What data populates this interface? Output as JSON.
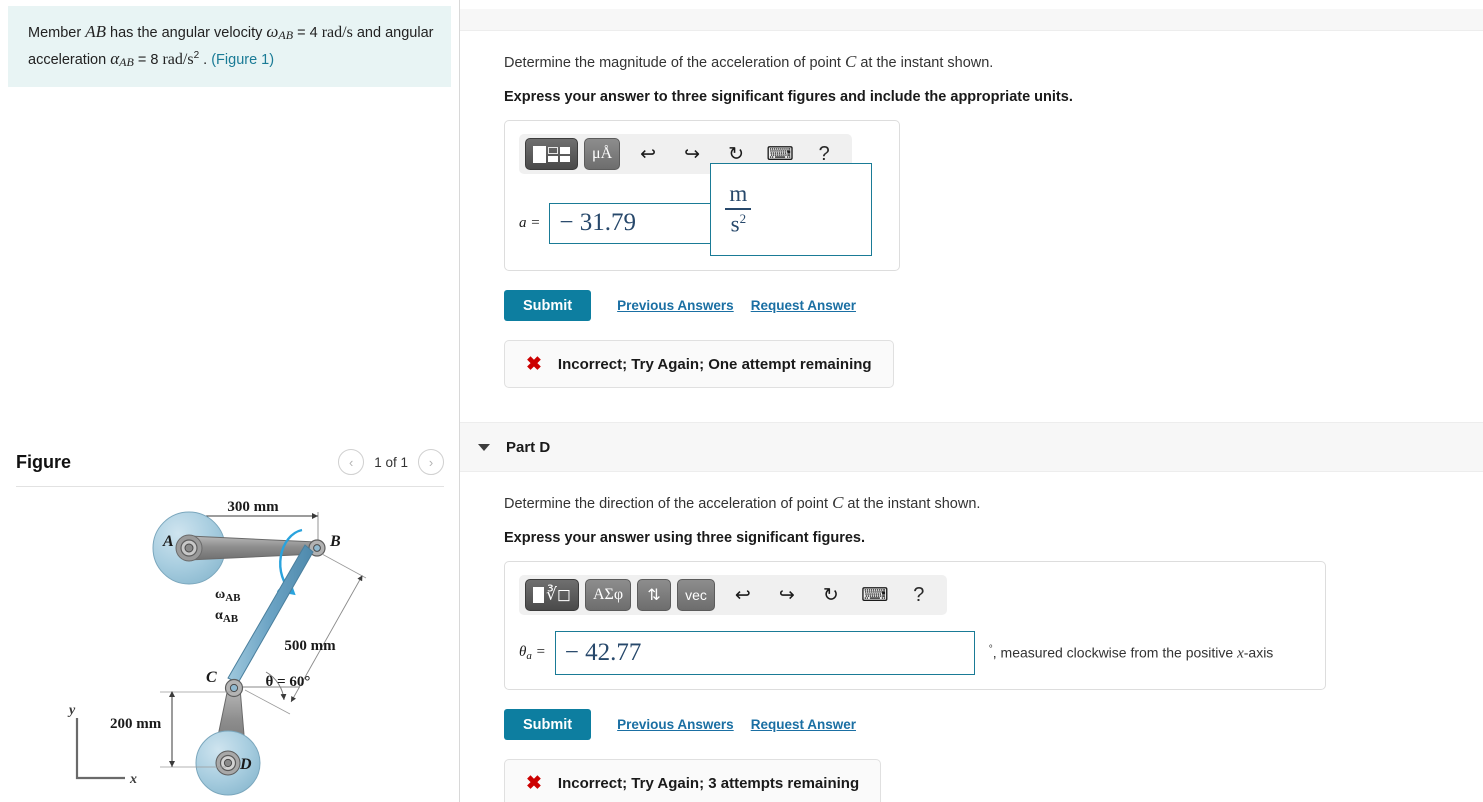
{
  "problem": {
    "line1_pre": "Member ",
    "member": "AB",
    "line1_mid": " has the angular velocity ",
    "omega": "ω",
    "omega_sub": "AB",
    "omega_eq": " = 4 ",
    "omega_units": "rad/s",
    "line1_post": " and",
    "line2_pre": "angular acceleration ",
    "alpha": "α",
    "alpha_sub": "AB",
    "alpha_eq": " = 8 ",
    "alpha_units": "rad/s",
    "alpha_units_exp": "2",
    "line2_post": " . ",
    "figure_link": "(Figure 1)"
  },
  "figure": {
    "title": "Figure",
    "pager_label": "1 of 1",
    "prev_icon": "‹",
    "next_icon": "›",
    "labels": {
      "A": "A",
      "B": "B",
      "C": "C",
      "D": "D",
      "omega_ab": "ω",
      "omega_ab_sub": "AB",
      "alpha_ab": "α",
      "alpha_ab_sub": "AB",
      "dim_top": "300 mm",
      "dim_mid": "500 mm",
      "dim_bottom": "200 mm",
      "theta": "θ = 60°",
      "axis_x": "x",
      "axis_y": "y"
    }
  },
  "part_c": {
    "question": "Determine the magnitude of the acceleration of point ",
    "question_symbol": "C",
    "question_tail": " at the instant shown.",
    "instruction": "Express your answer to three significant figures and include the appropriate units.",
    "toolbar": {
      "template_button": "template-icon",
      "units_button": "μÅ",
      "undo": "↩",
      "redo": "↪",
      "reset": "↻",
      "keyboard": "⌨",
      "help": "?"
    },
    "answer_label": "a",
    "answer_value": "− 31.79",
    "unit_numerator": "m",
    "unit_denominator": "s",
    "unit_denominator_exp": "2",
    "submit_label": "Submit",
    "previous_answers": "Previous Answers",
    "request_answer": "Request Answer",
    "feedback_icon": "✖",
    "feedback_text": "Incorrect; Try Again; One attempt remaining"
  },
  "part_d": {
    "header_label": "Part D",
    "question": "Determine the direction of the acceleration of point ",
    "question_symbol": "C",
    "question_tail": " at the instant shown.",
    "instruction": "Express your answer using three significant figures.",
    "toolbar": {
      "template_button": "root-template-icon",
      "greek_button": "ΑΣφ",
      "arrows_button": "⇅",
      "vec_button": "vec",
      "undo": "↩",
      "redo": "↪",
      "reset": "↻",
      "keyboard": "⌨",
      "help": "?"
    },
    "answer_label": "θ",
    "answer_label_sub": "a",
    "answer_value": "− 42.77",
    "suffix_degree": "°",
    "suffix_text": ", measured clockwise from the positive ",
    "suffix_axis": "x",
    "suffix_axis_tail": "-axis",
    "submit_label": "Submit",
    "previous_answers": "Previous Answers",
    "request_answer": "Request Answer",
    "feedback_icon": "✖",
    "feedback_text": "Incorrect; Try Again; 3 attempts remaining"
  },
  "colors": {
    "accent_teal": "#0d7ea0",
    "link_blue": "#1a6fa3",
    "error_red": "#cc0000",
    "problem_bg": "#e8f4f4",
    "field_border": "#1a7b96"
  }
}
